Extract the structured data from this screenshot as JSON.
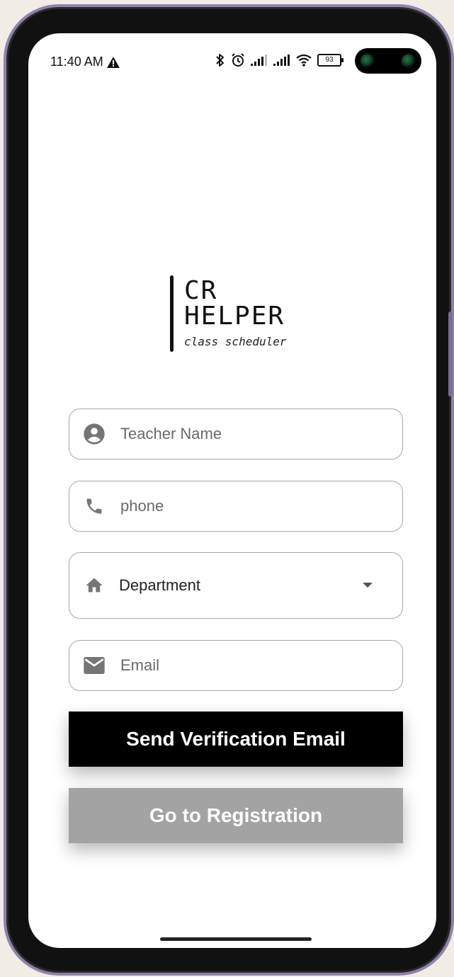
{
  "status_bar": {
    "time": "11:40 AM",
    "battery_level": "93",
    "icons": [
      "warning-icon",
      "bluetooth-icon",
      "alarm-icon",
      "signal-icon",
      "signal-icon",
      "wifi-icon",
      "battery-icon"
    ]
  },
  "logo": {
    "line1": "CR",
    "line2": "HELPER",
    "tagline": "class scheduler"
  },
  "form": {
    "teacher_name": {
      "placeholder": "Teacher Name",
      "icon": "account-circle-icon"
    },
    "phone": {
      "placeholder": "phone",
      "icon": "phone-icon"
    },
    "department": {
      "selected": "Department",
      "icon": "home-icon"
    },
    "email": {
      "placeholder": "Email",
      "icon": "mail-icon"
    }
  },
  "buttons": {
    "send_verification": "Send Verification Email",
    "go_to_registration": "Go to Registration"
  },
  "colors": {
    "primary_button": "#000000",
    "secondary_button": "#a3a3a3",
    "field_border": "#a9a9a9",
    "icon_gray": "#757575",
    "device_frame": "#8f82ad",
    "backdrop": "#f1ece4"
  }
}
